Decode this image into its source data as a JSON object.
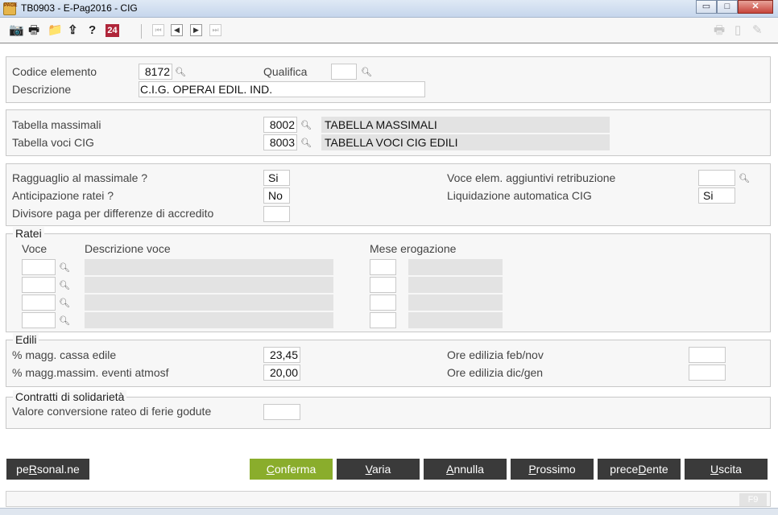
{
  "window": {
    "title": "TB0903  -  E-Pag2016  -  CIG",
    "app_icon_text": "PAGE",
    "minimize": "▭",
    "maximize": "□",
    "close": "✕"
  },
  "toolbar": {
    "camera": "📷",
    "print": "🖶",
    "folder": "📁",
    "export": "⇪",
    "help": "?",
    "calendar": "24",
    "nav_first": "⏮",
    "nav_prev": "◀",
    "nav_next": "▶",
    "nav_last": "⏭",
    "right_print": "🖶",
    "right_doc": "▯",
    "right_edit": "✎"
  },
  "header": {
    "codice_label": "Codice elemento",
    "codice_value": "8172",
    "qualifica_label": "Qualifica",
    "qualifica_value": "",
    "descrizione_label": "Descrizione",
    "descrizione_value": "C.I.G. OPERAI EDIL. IND."
  },
  "tabelle": {
    "massimali_label": "Tabella massimali",
    "massimali_code": "8002",
    "massimali_desc": "TABELLA MASSIMALI",
    "voci_label": "Tabella voci CIG",
    "voci_code": "8003",
    "voci_desc": "TABELLA VOCI CIG EDILI"
  },
  "opzioni": {
    "ragguaglio_label": "Ragguaglio al massimale ?",
    "ragguaglio_value": "Si",
    "anticipazione_label": "Anticipazione ratei ?",
    "anticipazione_value": "No",
    "divisore_label": "Divisore paga per differenze di accredito",
    "divisore_value": "",
    "voce_elem_label": "Voce elem. aggiuntivi retribuzione",
    "voce_elem_value": "",
    "liquidazione_label": "Liquidazione automatica CIG",
    "liquidazione_value": "Si"
  },
  "ratei": {
    "title": "Ratei",
    "col_voce": "Voce",
    "col_descrizione": "Descrizione voce",
    "col_mese": "Mese erogazione",
    "rows": [
      {
        "voce": "",
        "descrizione": "",
        "mese": "",
        "mese_desc": ""
      },
      {
        "voce": "",
        "descrizione": "",
        "mese": "",
        "mese_desc": ""
      },
      {
        "voce": "",
        "descrizione": "",
        "mese": "",
        "mese_desc": ""
      },
      {
        "voce": "",
        "descrizione": "",
        "mese": "",
        "mese_desc": ""
      }
    ]
  },
  "edili": {
    "title": "Edili",
    "cassa_label": "% magg. cassa edile",
    "cassa_value": "23,45",
    "massim_label": "% magg.massim. eventi atmosf",
    "massim_value": "20,00",
    "feb_nov_label": "Ore edilizia feb/nov",
    "feb_nov_value": "",
    "dic_gen_label": "Ore edilizia dic/gen",
    "dic_gen_value": ""
  },
  "contratti": {
    "title": "Contratti di solidarietà",
    "valore_label": "Valore conversione rateo di ferie godute",
    "valore_value": ""
  },
  "buttons": {
    "personal_pre": "pe",
    "personal_u": "R",
    "personal_post": "sonal.ne",
    "conferma_u": "C",
    "conferma_post": "onferma",
    "varia_u": "V",
    "varia_post": "aria",
    "annulla_u": "A",
    "annulla_post": "nnulla",
    "prossimo_u": "P",
    "prossimo_post": "rossimo",
    "precedente_pre": "prece",
    "precedente_u": "D",
    "precedente_post": "ente",
    "uscita_u": "U",
    "uscita_post": "scita"
  },
  "status": {
    "f9": "F9"
  },
  "colors": {
    "accent_green": "#8aad2c",
    "button_dark": "#3a3a3a",
    "readonly_grey": "#e3e3e3"
  }
}
